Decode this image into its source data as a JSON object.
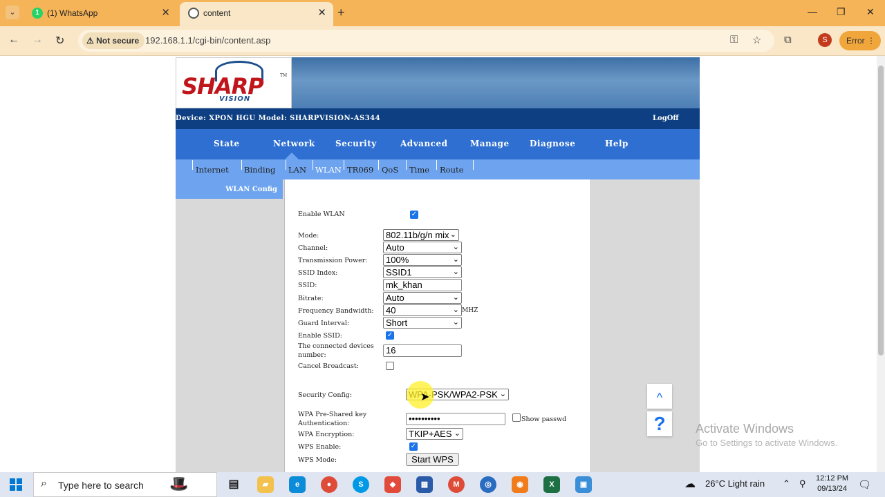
{
  "browser": {
    "tabs": [
      {
        "title": "(1) WhatsApp",
        "badge": "1"
      },
      {
        "title": "content"
      }
    ],
    "security_chip": "Not secure",
    "url": "192.168.1.1/cgi-bin/content.asp",
    "profile_initial": "S",
    "error_label": "Error"
  },
  "router": {
    "logo_text": "SHARP",
    "logo_sub": "VISION",
    "logo_tm": "TM",
    "device_info": "Device: XPON HGU  Model: SHARPVISION-AS344",
    "logoff": "LogOff",
    "main_nav": [
      "State",
      "Network",
      "Security",
      "Advanced",
      "Manage",
      "Diagnose",
      "Help"
    ],
    "sub_nav": [
      "Internet",
      "Binding",
      "LAN",
      "WLAN",
      "TR069",
      "QoS",
      "Time",
      "Route"
    ],
    "active_main": "Network",
    "active_sub": "WLAN",
    "side_heading": "WLAN Config",
    "form": {
      "enable_wlan_label": "Enable WLAN",
      "enable_wlan": true,
      "mode_label": "Mode:",
      "mode": "802.11b/g/n mix",
      "channel_label": "Channel:",
      "channel": "Auto",
      "tx_power_label": "Transmission Power:",
      "tx_power": "100%",
      "ssid_index_label": "SSID Index:",
      "ssid_index": "SSID1",
      "ssid_label": "SSID:",
      "ssid": "mk_khan",
      "bitrate_label": "Bitrate:",
      "bitrate": "Auto",
      "bandwidth_label": "Frequency Bandwidth:",
      "bandwidth": "40",
      "bandwidth_unit": "MHZ",
      "guard_label": "Guard Interval:",
      "guard": "Short",
      "enable_ssid_label": "Enable SSID:",
      "enable_ssid": true,
      "devices_label_1": "The connected devices",
      "devices_label_2": "number:",
      "devices": "16",
      "cancel_broadcast_label": "Cancel Broadcast:",
      "cancel_broadcast": false,
      "security_label": "Security Config:",
      "security": "WPA-PSK/WPA2-PSK",
      "psk_label_1": "WPA Pre-Shared key",
      "psk_label_2": "Authentication:",
      "psk": "••••••••••",
      "show_passwd_label": "Show passwd",
      "show_passwd": false,
      "encryption_label": "WPA Encryption:",
      "encryption": "TKIP+AES",
      "wps_enable_label": "WPS Enable:",
      "wps_enable": true,
      "wps_mode_label": "WPS Mode:",
      "wps_button": "Start WPS"
    }
  },
  "float_buttons": {
    "up": "^",
    "help": "?"
  },
  "watermark": {
    "line1": "Activate Windows",
    "line2": "Go to Settings to activate Windows."
  },
  "taskbar": {
    "search_placeholder": "Type here to search",
    "weather": "26°C  Light rain",
    "time": "12:12 PM",
    "date": "09/13/24"
  },
  "colors": {
    "browser_tabbar": "#f6b459",
    "router_darkbar": "#0d3f82",
    "router_nav": "#2e6fd1",
    "router_subnav": "#6ea4ef",
    "checkbox_on": "#1a73e8"
  }
}
